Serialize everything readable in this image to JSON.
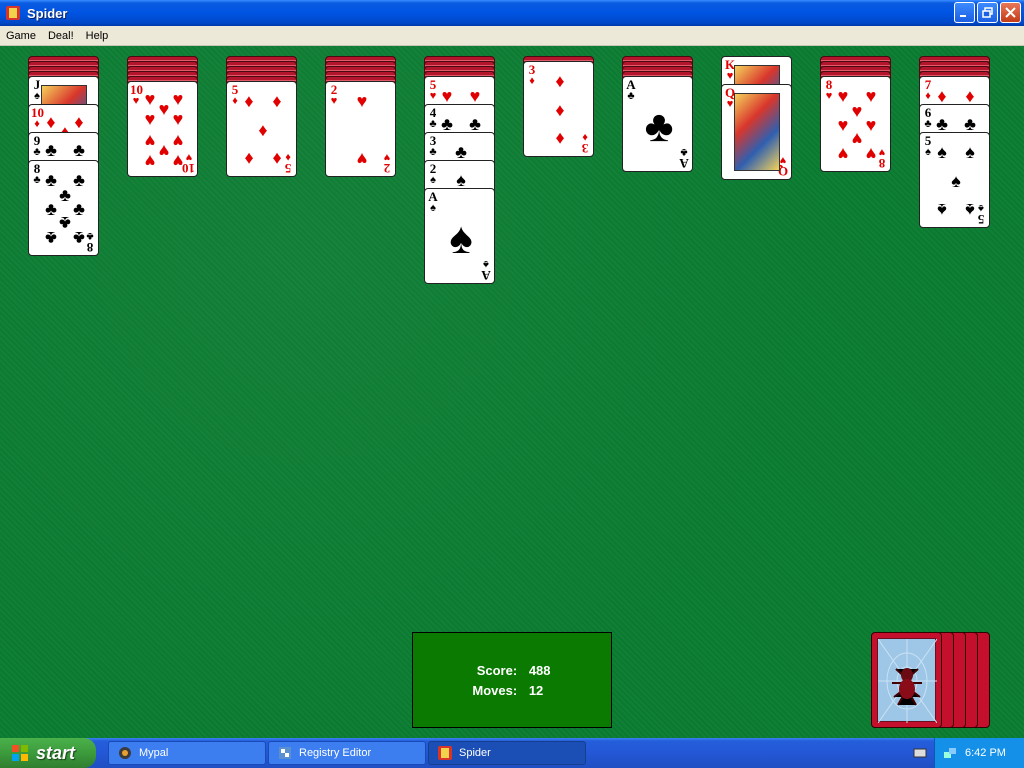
{
  "window": {
    "title": "Spider"
  },
  "menu": {
    "items": [
      "Game",
      "Deal!",
      "Help"
    ]
  },
  "score": {
    "score_label": "Score:",
    "score_value": "488",
    "moves_label": "Moves:",
    "moves_value": "12"
  },
  "taskbar": {
    "start_label": "start",
    "tasks": [
      "Mypal",
      "Registry Editor",
      "Spider"
    ],
    "clock": "6:42 PM"
  },
  "colors": {
    "felt": "#0b7d32",
    "card_back": "#b3162c",
    "red_suit": "#e00000",
    "taskbar": "#245edb"
  },
  "tableau": [
    {
      "hidden": 4,
      "cards": [
        "J♠",
        "10♦",
        "9♣",
        "8♣"
      ]
    },
    {
      "hidden": 5,
      "cards": [
        "10♥"
      ]
    },
    {
      "hidden": 5,
      "cards": [
        "5♦"
      ]
    },
    {
      "hidden": 5,
      "cards": [
        "2♥"
      ]
    },
    {
      "hidden": 4,
      "cards": [
        "5♥",
        "4♣",
        "3♣",
        "2♠",
        "A♠"
      ]
    },
    {
      "hidden": 1,
      "cards": [
        "3♦"
      ]
    },
    {
      "hidden": 4,
      "cards": [
        "A♣"
      ]
    },
    {
      "hidden": 0,
      "cards": [
        "K♥",
        "Q♥"
      ]
    },
    {
      "hidden": 4,
      "cards": [
        "8♥"
      ]
    },
    {
      "hidden": 4,
      "cards": [
        "7♦",
        "6♣",
        "5♠"
      ]
    }
  ],
  "stock": {
    "piles": 5
  }
}
